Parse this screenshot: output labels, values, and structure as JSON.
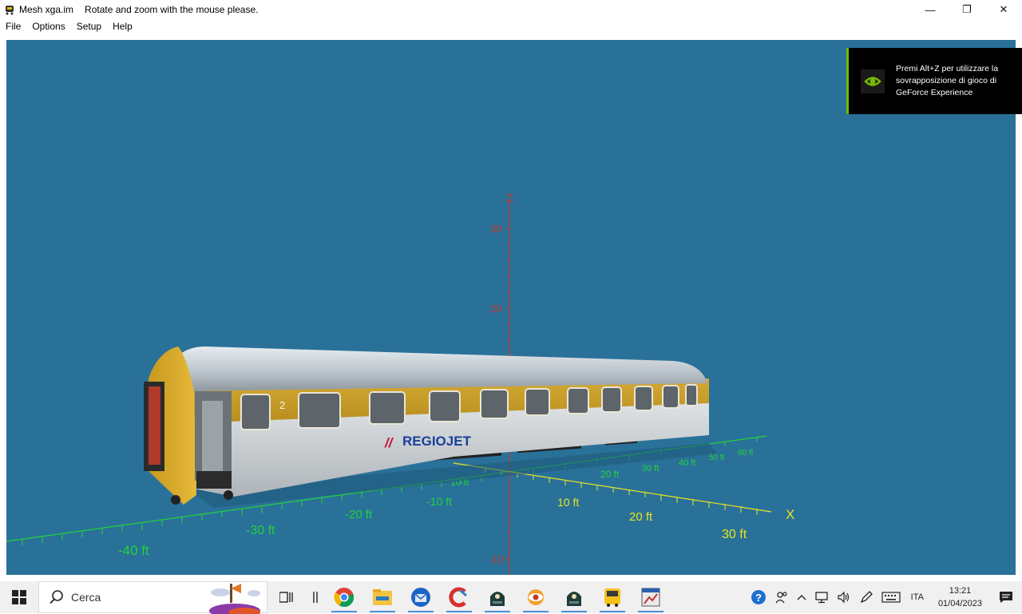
{
  "window": {
    "title": "Mesh xga.im",
    "message": "Rotate and zoom with the mouse please.",
    "controls": {
      "minimize": "—",
      "restore": "❐",
      "close": "✕"
    }
  },
  "menu": [
    "File",
    "Options",
    "Setup",
    "Help"
  ],
  "viewport": {
    "background": "#2a7199",
    "axes": {
      "z_label": "Z",
      "x_label": "X",
      "z_ticks": [
        "30",
        "20",
        "-10"
      ],
      "x_ticks": [
        "10 ft",
        "20 ft",
        "30 ft"
      ],
      "y_ticks": [
        "-40 ft",
        "-30 ft",
        "-20 ft",
        "-10 ft",
        "10 ft",
        "20 ft",
        "30 ft",
        "40 ft",
        "50 ft",
        "60 ft"
      ]
    },
    "model": {
      "brand": "REGIOJET",
      "coach_class": "2"
    }
  },
  "notification": {
    "text": "Premi Alt+Z per utilizzare la sovrapposizione di gioco di GeForce Experience",
    "accent": "#76b900"
  },
  "taskbar": {
    "search_placeholder": "Cerca",
    "language": "ITA",
    "time": "13:21",
    "date": "01/04/2023",
    "apps": [
      "task-view-icon",
      "widgets-icon",
      "chrome-icon",
      "file-explorer-icon",
      "thunderbird-icon",
      "ccleaner-icon",
      "trainz-icon",
      "xnview-icon",
      "trainz-icon-2",
      "bus-icon",
      "mesh-viewer-icon"
    ]
  }
}
